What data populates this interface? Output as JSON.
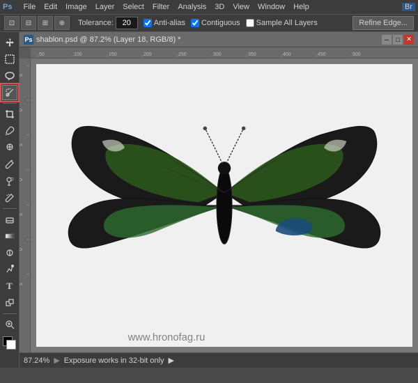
{
  "menubar": {
    "logo": "Ps",
    "items": [
      "File",
      "Edit",
      "Image",
      "Layer",
      "Select",
      "Filter",
      "Analysis",
      "3D",
      "View",
      "Window",
      "Help",
      "Br"
    ]
  },
  "optionsbar": {
    "tolerance_label": "Tolerance:",
    "tolerance_value": "20",
    "antialias_label": "Anti-alias",
    "antialias_checked": true,
    "contiguous_label": "Contiguous",
    "contiguous_checked": true,
    "sample_all_label": "Sample All Layers",
    "sample_all_checked": false,
    "refine_btn": "Refine Edge..."
  },
  "toolbar": {
    "tools": [
      {
        "name": "move-tool",
        "icon": "✥",
        "active": false
      },
      {
        "name": "selection-tool",
        "icon": "⬚",
        "active": false
      },
      {
        "name": "lasso-tool",
        "icon": "⌕",
        "active": false
      },
      {
        "name": "magic-wand-tool",
        "icon": "✦",
        "active": true,
        "selected": true
      },
      {
        "name": "crop-tool",
        "icon": "⬛",
        "active": false
      },
      {
        "name": "eyedropper-tool",
        "icon": "✒",
        "active": false
      },
      {
        "name": "healing-tool",
        "icon": "✜",
        "active": false
      },
      {
        "name": "brush-tool",
        "icon": "✏",
        "active": false
      },
      {
        "name": "clone-tool",
        "icon": "⊕",
        "active": false
      },
      {
        "name": "history-tool",
        "icon": "⟳",
        "active": false
      },
      {
        "name": "eraser-tool",
        "icon": "◻",
        "active": false
      },
      {
        "name": "gradient-tool",
        "icon": "▦",
        "active": false
      },
      {
        "name": "dodge-tool",
        "icon": "◯",
        "active": false
      },
      {
        "name": "pen-tool",
        "icon": "✒",
        "active": false
      },
      {
        "name": "type-tool",
        "icon": "T",
        "active": false
      },
      {
        "name": "shape-tool",
        "icon": "◰",
        "active": false
      },
      {
        "name": "zoom-tool",
        "icon": "🔍",
        "active": false
      }
    ]
  },
  "document": {
    "title": "shablon.psd @ 87.2% (Layer 18, RGB/8) *",
    "ps_icon": "Ps",
    "ruler_labels": [
      "50",
      "100",
      "150",
      "200",
      "250",
      "300",
      "350",
      "400",
      "450",
      "500"
    ],
    "ruler_v_labels": [
      "5",
      "0",
      "5",
      "0",
      "5",
      "0",
      "5"
    ]
  },
  "statusbar": {
    "zoom": "87.24%",
    "info": "Exposure works in 32-bit only",
    "watermark": "www.hronofag.ru"
  },
  "colors": {
    "accent": "#1f6fad",
    "selected_tool_outline": "#e05050",
    "close_btn": "#c0392b",
    "menu_bg": "#3c3c3c",
    "canvas_bg": "#787878"
  }
}
